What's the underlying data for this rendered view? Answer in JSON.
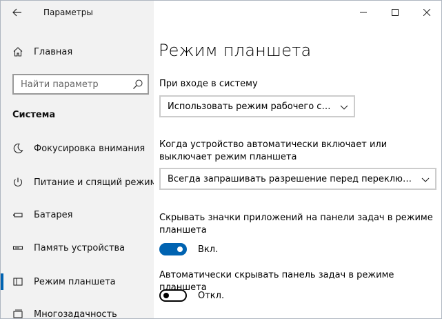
{
  "app": {
    "title": "Параметры"
  },
  "sidebar": {
    "home_label": "Главная",
    "search_placeholder": "Найти параметр",
    "section_title": "Система",
    "items": [
      {
        "label": "Фокусировка внимания",
        "icon": "moon-icon"
      },
      {
        "label": "Питание и спящий режим",
        "icon": "power-icon"
      },
      {
        "label": "Батарея",
        "icon": "battery-icon"
      },
      {
        "label": "Память устройства",
        "icon": "storage-icon"
      },
      {
        "label": "Режим планшета",
        "icon": "tablet-mode-icon",
        "active": true
      },
      {
        "label": "Многозадачность",
        "icon": "multitasking-icon"
      }
    ]
  },
  "main": {
    "page_title": "Режим планшета",
    "signin_label": "При входе в систему",
    "signin_value": "Использовать режим рабочего стола",
    "auto_switch_label": "Когда устройство автоматически включает или выключает режим планшета",
    "auto_switch_value": "Всегда запрашивать разрешение перед переключени…",
    "hide_icons_label": "Скрывать значки приложений на панели задач в режиме планшета",
    "hide_icons_state": "Вкл.",
    "hide_taskbar_label": "Автоматически скрывать панель задач в режиме планшета",
    "hide_taskbar_state": "Откл."
  },
  "colors": {
    "accent": "#0063b1",
    "sidebar_bg": "#f2f2f2"
  }
}
